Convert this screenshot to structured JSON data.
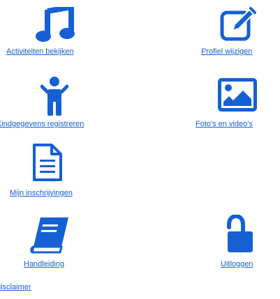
{
  "colors": {
    "accent": "#1560d4",
    "link": "#1560d4"
  },
  "menu": {
    "activities": {
      "label": "Activiteiten bekijken",
      "icon": "music-note-icon"
    },
    "profile": {
      "label": "Profiel wijzigen",
      "icon": "edit-icon"
    },
    "child_data": {
      "label": "Kindgegevens registreren",
      "icon": "child-icon"
    },
    "photos": {
      "label": "Foto's en video's",
      "icon": "image-icon"
    },
    "registrations": {
      "label": "Mijn inschrijvingen",
      "icon": "document-icon"
    },
    "manual": {
      "label": "Handleiding",
      "icon": "book-icon"
    },
    "logout": {
      "label": "Uitloggen",
      "icon": "unlock-icon"
    },
    "disclaimer": {
      "label": "disclaimer"
    }
  }
}
